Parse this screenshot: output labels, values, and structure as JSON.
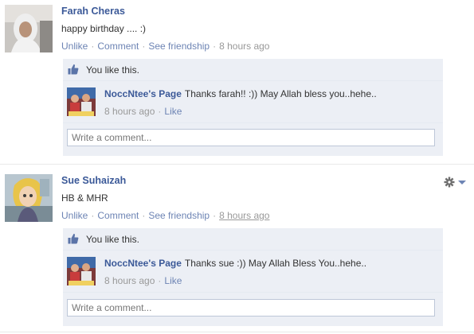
{
  "posts": [
    {
      "author": "Farah Cheras",
      "message": "happy birthday .... :)",
      "actions": {
        "unlike": "Unlike",
        "comment": "Comment",
        "friendship": "See friendship",
        "time": "8 hours ago"
      },
      "likes_text": "You like this.",
      "reply": {
        "author": "NoccNtee's Page",
        "text": "Thanks farah!! :)) May Allah bless you..hehe..",
        "time": "8 hours ago",
        "like": "Like"
      },
      "comment_placeholder": "Write a comment..."
    },
    {
      "author": "Sue Suhaizah",
      "message": "HB & MHR",
      "actions": {
        "unlike": "Unlike",
        "comment": "Comment",
        "friendship": "See friendship",
        "time": "8 hours ago"
      },
      "likes_text": "You like this.",
      "reply": {
        "author": "NoccNtee's Page",
        "text": "Thanks sue :)) May Allah Bless You..hehe..",
        "time": "8 hours ago",
        "like": "Like"
      },
      "comment_placeholder": "Write a comment..."
    }
  ],
  "separator_dot": "·",
  "icons": {
    "like": "thumbs-up-icon",
    "options": "gear-icon"
  },
  "colors": {
    "link": "#3b5998",
    "meta_link": "#6d84b4",
    "ufi_bg": "#eceff5",
    "input_border": "#bdc7d8"
  }
}
